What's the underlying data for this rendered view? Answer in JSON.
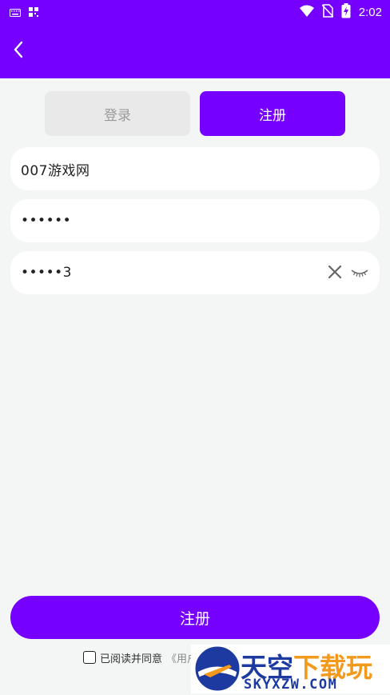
{
  "status_bar": {
    "time": "2:02",
    "icons": [
      "keyboard-icon",
      "qr-icon",
      "wifi-icon",
      "no-sim-icon",
      "battery-charging-icon"
    ]
  },
  "app_bar": {
    "back_icon": "chevron-left-icon"
  },
  "tabs": {
    "login_label": "登录",
    "register_label": "注册",
    "active": "register"
  },
  "form": {
    "username_value": "007游戏网",
    "password_value": "••••••",
    "confirm_value": "•••••3",
    "confirm_icons": [
      "clear-icon",
      "eye-closed-icon"
    ]
  },
  "submit_label": "注册",
  "agreement": {
    "text": "已阅读并同意",
    "link_visible": "《用户"
  },
  "watermark": {
    "cn_main": "天空",
    "cn_accent": "下载玩",
    "en": "SKYXZW.COM"
  },
  "colors": {
    "accent": "#7600ff",
    "background": "#f4f5f5",
    "tab_inactive": "#e9e9ea"
  }
}
